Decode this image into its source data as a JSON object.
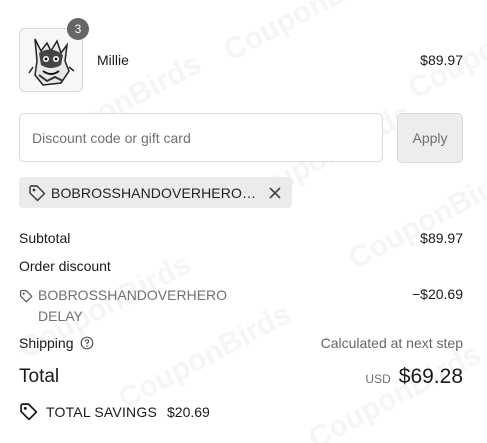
{
  "watermark": "CouponBirds",
  "product": {
    "quantity": "3",
    "name": "Millie",
    "price": "$89.97"
  },
  "discount": {
    "placeholder": "Discount code or gift card",
    "apply_label": "Apply",
    "applied_code": "BOBROSSHANDOVERHERODELAY"
  },
  "summary": {
    "subtotal_label": "Subtotal",
    "subtotal_value": "$89.97",
    "order_discount_label": "Order discount",
    "discount_code": "BOBROSSHANDOVERHERO DELAY",
    "discount_value": "−$20.69",
    "shipping_label": "Shipping",
    "shipping_value": "Calculated at next step",
    "total_label": "Total",
    "currency": "USD",
    "total_value": "$69.28",
    "savings_label": "TOTAL SAVINGS",
    "savings_value": "$20.69"
  }
}
